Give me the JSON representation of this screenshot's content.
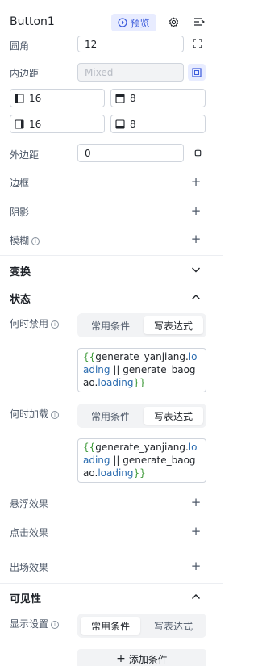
{
  "header": {
    "title": "Button1",
    "preview_label": "预览"
  },
  "props": {
    "radius": {
      "label": "圆角",
      "value": "12"
    },
    "padding": {
      "label": "内边距",
      "placeholder": "Mixed",
      "left": "16",
      "top": "8",
      "right": "16",
      "bottom": "8"
    },
    "margin": {
      "label": "外边距",
      "value": "0"
    },
    "border": {
      "label": "边框"
    },
    "shadow": {
      "label": "阴影"
    },
    "blur": {
      "label": "模糊"
    }
  },
  "sections": {
    "transform": {
      "title": "变换"
    },
    "state": {
      "title": "状态"
    },
    "visibility": {
      "title": "可见性"
    }
  },
  "state": {
    "disabled": {
      "label": "何时禁用",
      "tabs": [
        "常用条件",
        "写表达式"
      ],
      "expr": {
        "open": "{{",
        "id1": "generate_yanjiang",
        "dot1": ".",
        "prop1": "loading",
        "op": " || ",
        "id2": "generate_baogao",
        "dot2": ".",
        "prop2": "loading",
        "close": "}}"
      }
    },
    "loading": {
      "label": "何时加载",
      "tabs": [
        "常用条件",
        "写表达式"
      ],
      "expr": {
        "open": "{{",
        "id1": "generate_yanjiang",
        "dot1": ".",
        "prop1": "loading",
        "op": " || ",
        "id2": "generate_baogao",
        "dot2": ".",
        "prop2": "loading",
        "close": "}}"
      }
    },
    "hover": {
      "label": "悬浮效果"
    },
    "click": {
      "label": "点击效果"
    },
    "enter": {
      "label": "出场效果"
    }
  },
  "visibility": {
    "display": {
      "label": "显示设置",
      "tabs": [
        "常用条件",
        "写表达式"
      ]
    },
    "add_condition": "添加条件"
  }
}
